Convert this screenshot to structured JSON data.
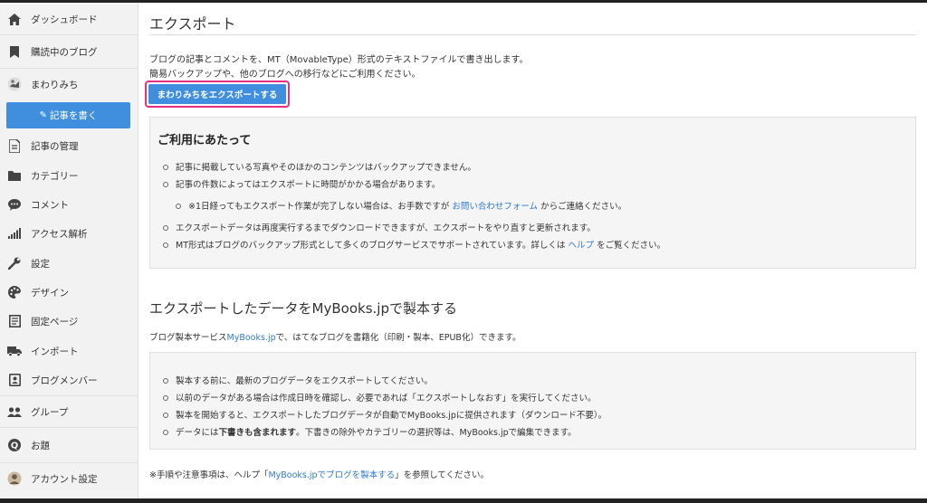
{
  "sidebar": {
    "items": [
      {
        "label": "ダッシュボード",
        "icon": "home-icon"
      },
      {
        "label": "購読中のブログ",
        "icon": "bookmark-icon"
      },
      {
        "label": "まわりみち",
        "icon": "blog-avatar-icon"
      },
      {
        "label": "記事の管理",
        "icon": "document-icon"
      },
      {
        "label": "カテゴリー",
        "icon": "folder-icon"
      },
      {
        "label": "コメント",
        "icon": "comment-icon"
      },
      {
        "label": "アクセス解析",
        "icon": "bar-chart-icon"
      },
      {
        "label": "設定",
        "icon": "wrench-icon"
      },
      {
        "label": "デザイン",
        "icon": "palette-icon"
      },
      {
        "label": "固定ページ",
        "icon": "page-icon"
      },
      {
        "label": "インポート",
        "icon": "truck-icon"
      },
      {
        "label": "ブログメンバー",
        "icon": "members-icon"
      },
      {
        "label": "グループ",
        "icon": "group-icon"
      },
      {
        "label": "お題",
        "icon": "question-icon"
      },
      {
        "label": "アカウント設定",
        "icon": "account-avatar-icon"
      }
    ],
    "write_button": "記事を書く"
  },
  "main": {
    "title": "エクスポート",
    "description_1": "ブログの記事とコメントを、MT（MovableType）形式のテキストファイルで書き出します。",
    "description_2": "簡易バックアップや、他のブログへの移行などにご利用ください。",
    "export_button": "まわりみちをエクスポートする",
    "notice": {
      "heading": "ご利用にあたって",
      "b1": "記事に掲載している写真やそのほかのコンテンツはバックアップできません。",
      "b2": "記事の件数によってはエクスポートに時間がかかる場合があります。",
      "b3_pre": "※1日経ってもエクスポート作業が完了しない場合は、お手数ですが",
      "b3_link": "お問い合わせフォーム",
      "b3_post": "からご連絡ください。",
      "b4": "エクスポートデータは再度実行するまでダウンロードできますが、エクスポートをやり直すと更新されます。",
      "b5_pre": "MT形式はブログのバックアップ形式として多くのブログサービスでサポートされています。詳しくは",
      "b5_link": "ヘルプ",
      "b5_post": "をご覧ください。"
    },
    "mybooks": {
      "title": "エクスポートしたデータをMyBooks.jpで製本する",
      "desc_pre": "ブログ製本サービス",
      "desc_link": "MyBooks.jp",
      "desc_post": "で、はてなブログを書籍化（印刷・製本、EPUB化）できます。",
      "b1": "製本する前に、最新のブログデータをエクスポートしてください。",
      "b2": "以前のデータがある場合は作成日時を確認し、必要であれば「エクスポートしなおす」を実行してください。",
      "b3": "製本を開始すると、エクスポートしたブログデータが自動でMyBooks.jpに提供されます（ダウンロード不要）。",
      "b4_pre": "データには",
      "b4_bold": "下書きも含まれます",
      "b4_post": "。下書きの除外やカテゴリーの選択等は、MyBooks.jpで編集できます。",
      "footer_pre": "※手順や注意事項は、ヘルプ「",
      "footer_link": "MyBooks.jpでブログを製本する",
      "footer_post": "」を参照してください。"
    }
  },
  "colors": {
    "accent": "#3f8fde",
    "highlight": "#e8327f",
    "link": "#2f7bd0",
    "panel": "#f5f5f5"
  }
}
